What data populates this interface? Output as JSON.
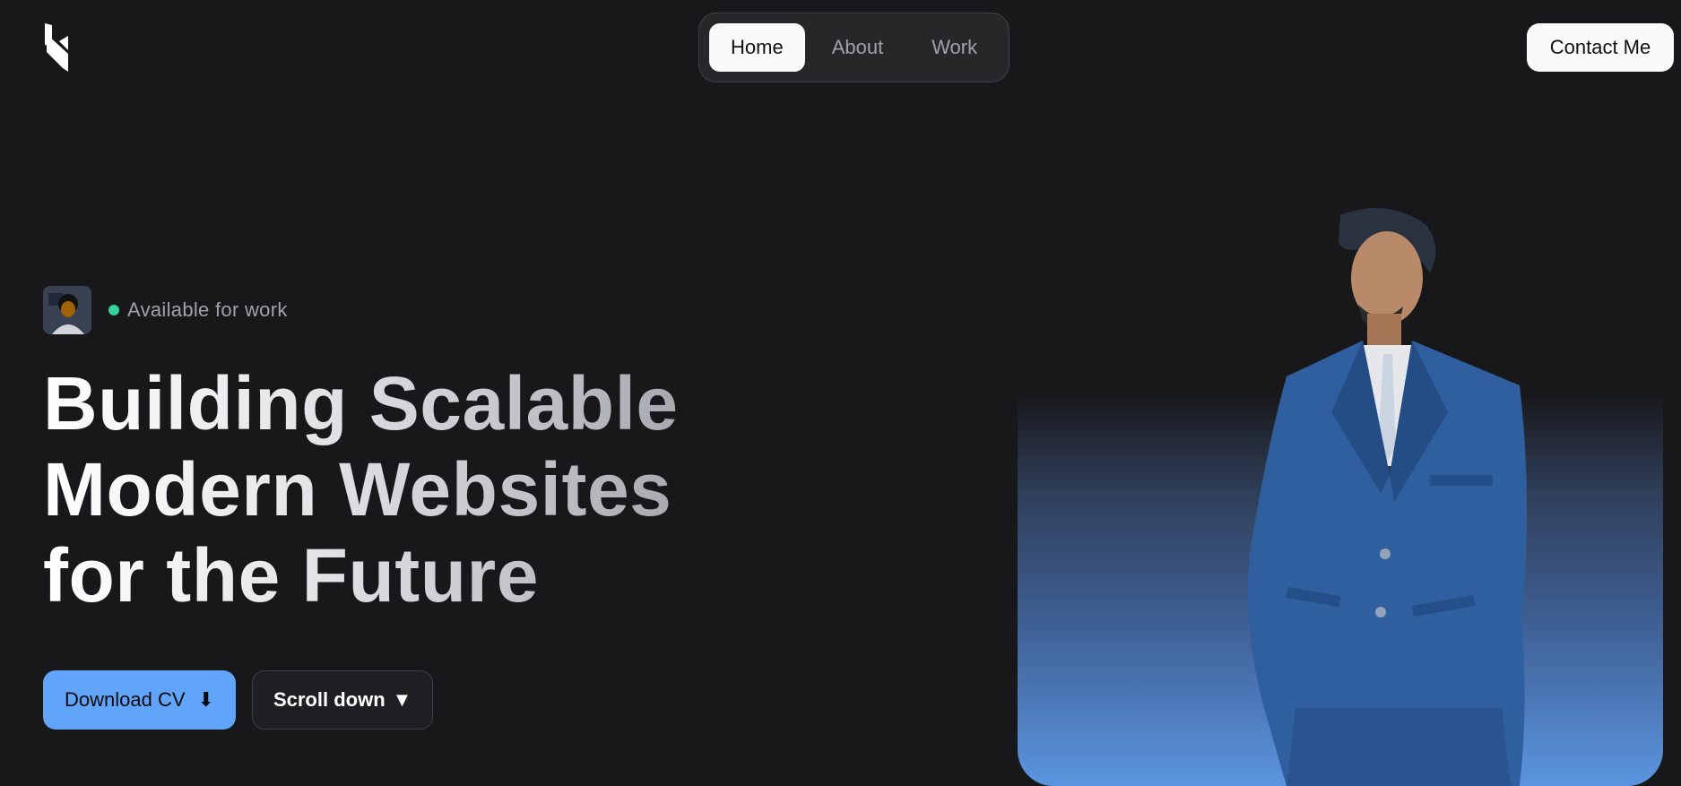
{
  "header": {
    "logo_icon": "k-logo-icon",
    "nav": [
      {
        "label": "Home",
        "active": true
      },
      {
        "label": "About",
        "active": false
      },
      {
        "label": "Work",
        "active": false
      }
    ],
    "contact_label": "Contact Me"
  },
  "hero": {
    "status_text": "Available for work",
    "status_color": "#34d399",
    "headline_lines": [
      "Building Scalable",
      "Modern Websites",
      "for the Future"
    ],
    "download_label": "Download CV",
    "download_icon": "⬇",
    "scroll_label": "Scroll down",
    "scroll_icon": "▼",
    "accent_color": "#60a5fa"
  }
}
